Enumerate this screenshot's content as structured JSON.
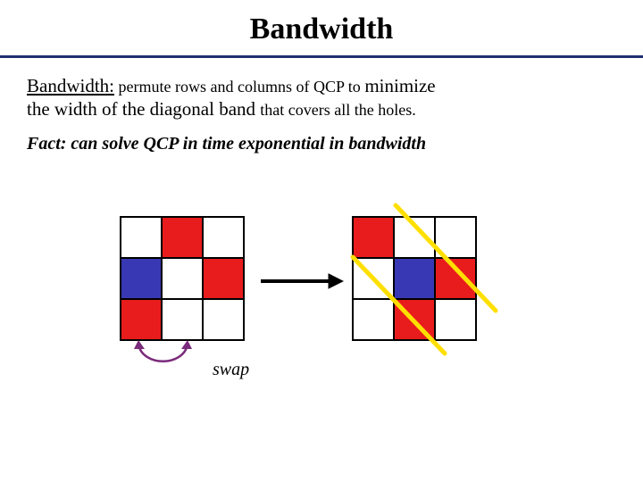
{
  "title": "Bandwidth",
  "body": {
    "lead": "Bandwidth:",
    "part1": " permute rows and columns of QCP to ",
    "emph1": "minimize",
    "part2": "the width of the diagonal band ",
    "tail": "that covers all the holes."
  },
  "fact": "Fact: can solve QCP in time exponential in bandwidth",
  "swap_label": "swap",
  "chart_data": [
    {
      "type": "table",
      "title": "left-grid",
      "rows": [
        [
          "white",
          "red",
          "white"
        ],
        [
          "blue",
          "white",
          "red"
        ],
        [
          "red",
          "white",
          "white"
        ]
      ],
      "annotations": [
        "swap columns 1 and 2"
      ]
    },
    {
      "type": "table",
      "title": "right-grid",
      "rows": [
        [
          "red",
          "white",
          "white"
        ],
        [
          "white",
          "blue",
          "red"
        ],
        [
          "white",
          "red",
          "white"
        ]
      ],
      "annotations": [
        "diagonal band shown"
      ]
    }
  ]
}
